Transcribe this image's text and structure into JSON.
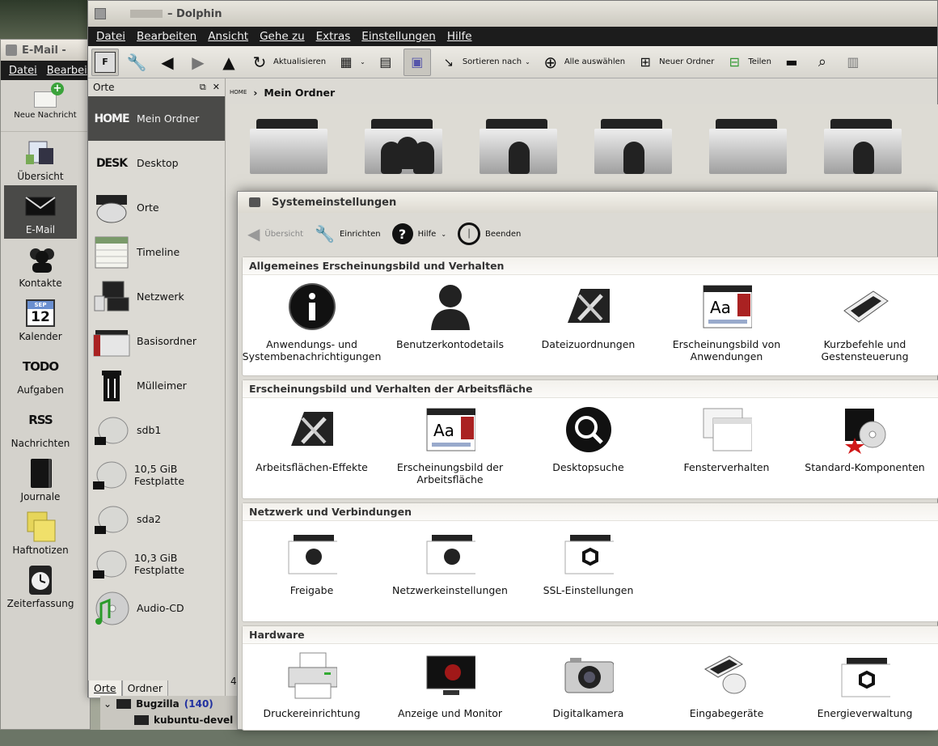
{
  "mail": {
    "title": "E-Mail -",
    "menu": [
      "Datei",
      "Bearbei"
    ],
    "new_message": "Neue Nachricht",
    "items": [
      {
        "label": "Übersicht",
        "icon": "overview-icon"
      },
      {
        "label": "E-Mail",
        "icon": "envelope-icon"
      },
      {
        "label": "Kontakte",
        "icon": "contacts-icon"
      },
      {
        "label": "Kalender",
        "icon": "calendar-icon",
        "month": "SEP",
        "day": "12"
      },
      {
        "label": "Aufgaben",
        "icon": "todo-icon",
        "text": "TODO"
      },
      {
        "label": "Nachrichten",
        "icon": "rss-icon",
        "text": "RSS"
      },
      {
        "label": "Journale",
        "icon": "journal-icon"
      },
      {
        "label": "Haftnotizen",
        "icon": "sticky-notes-icon"
      },
      {
        "label": "Zeiterfassung",
        "icon": "clock-icon"
      }
    ]
  },
  "dolphin": {
    "title": "– Dolphin",
    "menu": [
      "Datei",
      "Bearbeiten",
      "Ansicht",
      "Gehe zu",
      "Extras",
      "Einstellungen",
      "Hilfe"
    ],
    "toolbar": {
      "refresh": "Aktualisieren",
      "sort": "Sortieren nach",
      "select_all": "Alle auswählen",
      "new_folder": "Neuer Ordner",
      "split": "Teilen"
    },
    "places_title": "Orte",
    "places": [
      {
        "label": "Mein Ordner",
        "icon": "home-icon",
        "text": "HOME"
      },
      {
        "label": "Desktop",
        "icon": "desktop-icon",
        "text": "DESK"
      },
      {
        "label": "Orte",
        "icon": "places-icon"
      },
      {
        "label": "Timeline",
        "icon": "timeline-icon"
      },
      {
        "label": "Netzwerk",
        "icon": "network-icon"
      },
      {
        "label": "Basisordner",
        "icon": "root-folder-icon"
      },
      {
        "label": "Mülleimer",
        "icon": "trash-icon"
      },
      {
        "label": "sdb1",
        "icon": "drive-icon"
      },
      {
        "label": "10,5 GiB Festplatte",
        "icon": "drive-icon"
      },
      {
        "label": "sda2",
        "icon": "drive-icon"
      },
      {
        "label": "10,3 GiB Festplatte",
        "icon": "drive-icon"
      },
      {
        "label": "Audio-CD",
        "icon": "audio-cd-icon"
      }
    ],
    "tabs": [
      "Orte",
      "Ordner"
    ],
    "breadcrumb_home": "HOME",
    "breadcrumb": "Mein Ordner",
    "status_fragment": "4"
  },
  "tree": {
    "bugzilla": "Bugzilla",
    "bugzilla_count": "(140)",
    "kubuntu": "kubuntu-devel",
    "kubuntu_count": "("
  },
  "systemsettings": {
    "title": "Systemeinstellungen",
    "toolbar": {
      "overview": "Übersicht",
      "configure": "Einrichten",
      "help": "Hilfe",
      "quit": "Beenden"
    },
    "categories": [
      {
        "title": "Allgemeines Erscheinungsbild und Verhalten",
        "items": [
          {
            "label": "Anwendungs- und Systembenachrichtigungen",
            "icon": "info-icon"
          },
          {
            "label": "Benutzerkontodetails",
            "icon": "user-icon"
          },
          {
            "label": "Dateizuordnungen",
            "icon": "tools-icon"
          },
          {
            "label": "Erscheinungsbild von Anwendungen",
            "icon": "appearance-icon"
          },
          {
            "label": "Kurzbefehle und Gestensteuerung",
            "icon": "keyboard-icon"
          }
        ]
      },
      {
        "title": "Erscheinungsbild und Verhalten der Arbeitsfläche",
        "items": [
          {
            "label": "Arbeitsflächen-Effekte",
            "icon": "tools-icon"
          },
          {
            "label": "Erscheinungsbild der Arbeitsfläche",
            "icon": "appearance-icon"
          },
          {
            "label": "Desktopsuche",
            "icon": "search-icon"
          },
          {
            "label": "Fensterverhalten",
            "icon": "windows-icon"
          },
          {
            "label": "Standard-Komponenten",
            "icon": "components-icon"
          }
        ]
      },
      {
        "title": "Netzwerk und Verbindungen",
        "items": [
          {
            "label": "Freigabe",
            "icon": "network-folder-icon"
          },
          {
            "label": "Netzwerkeinstellungen",
            "icon": "network-folder-icon"
          },
          {
            "label": "SSL-Einstellungen",
            "icon": "ssl-folder-icon"
          }
        ]
      },
      {
        "title": "Hardware",
        "items": [
          {
            "label": "Druckereinrichtung",
            "icon": "printer-icon"
          },
          {
            "label": "Anzeige und Monitor",
            "icon": "monitor-icon"
          },
          {
            "label": "Digitalkamera",
            "icon": "camera-icon"
          },
          {
            "label": "Eingabegeräte",
            "icon": "input-devices-icon"
          },
          {
            "label": "Energieverwaltung",
            "icon": "power-folder-icon"
          }
        ]
      }
    ]
  }
}
